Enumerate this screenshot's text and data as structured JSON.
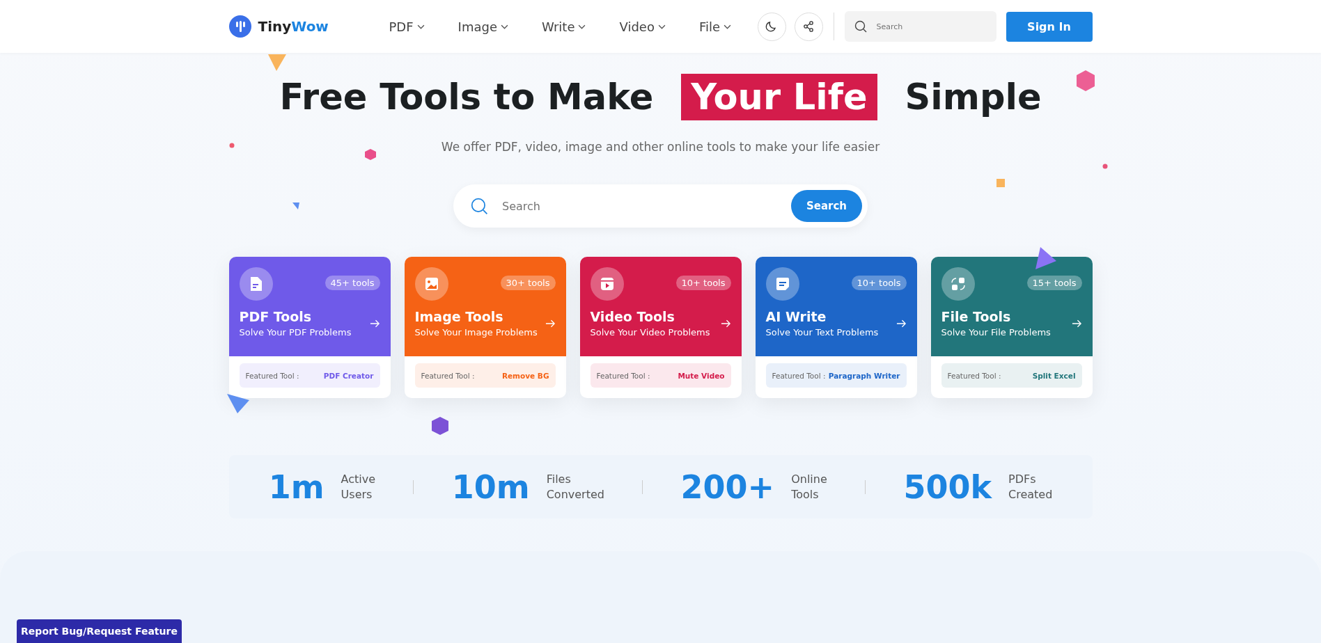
{
  "header": {
    "logo_text_a": "Tiny",
    "logo_text_b": "Wow",
    "nav": [
      {
        "label": "PDF"
      },
      {
        "label": "Image"
      },
      {
        "label": "Write"
      },
      {
        "label": "Video"
      },
      {
        "label": "File"
      }
    ],
    "search": {
      "placeholder": "Search"
    },
    "sign_in": "Sign In"
  },
  "hero": {
    "title_before": "Free Tools to Make",
    "title_highlight": "Your Life",
    "title_after": "Simple",
    "subtitle": "We offer PDF, video, image and other online tools to make your life easier",
    "search": {
      "placeholder": "Search",
      "button": "Search"
    }
  },
  "cards": [
    {
      "kind": "pdf",
      "color": "#6f5ae9",
      "count": "45+ tools",
      "title": "PDF Tools",
      "subtitle": "Solve Your PDF Problems",
      "featured_label": "Featured Tool :",
      "featured": "PDF Creator"
    },
    {
      "kind": "image",
      "color": "#f56215",
      "count": "30+ tools",
      "title": "Image Tools",
      "subtitle": "Solve Your Image Problems",
      "featured_label": "Featured Tool :",
      "featured": "Remove BG"
    },
    {
      "kind": "video",
      "color": "#d41c4b",
      "count": "10+ tools",
      "title": "Video Tools",
      "subtitle": "Solve Your Video Problems",
      "featured_label": "Featured Tool :",
      "featured": "Mute Video"
    },
    {
      "kind": "write",
      "color": "#1e66c8",
      "count": "10+ tools",
      "title": "AI Write",
      "subtitle": "Solve Your Text Problems",
      "featured_label": "Featured Tool :",
      "featured": "Paragraph Writer"
    },
    {
      "kind": "file",
      "color": "#22767b",
      "count": "15+ tools",
      "title": "File Tools",
      "subtitle": "Solve Your File Problems",
      "featured_label": "Featured Tool :",
      "featured": "Split Excel"
    }
  ],
  "stats": [
    {
      "value": "1m",
      "line1": "Active",
      "line2": "Users"
    },
    {
      "value": "10m",
      "line1": "Files",
      "line2": "Converted"
    },
    {
      "value": "200+",
      "line1": "Online",
      "line2": "Tools"
    },
    {
      "value": "500k",
      "line1": "PDFs",
      "line2": "Created"
    }
  ],
  "report_button": "Report Bug/Request Feature"
}
